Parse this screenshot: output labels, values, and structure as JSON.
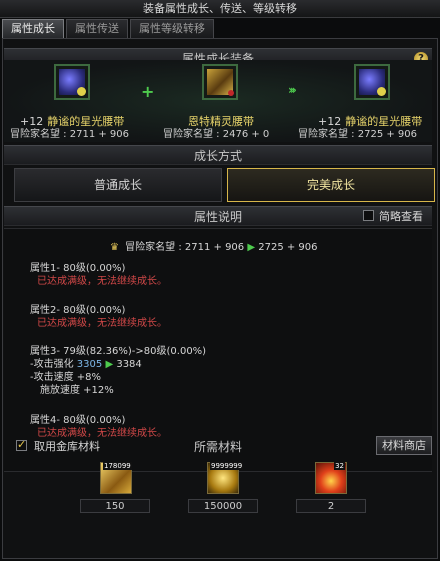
{
  "window": {
    "title": "装备属性成长、传送、等级转移"
  },
  "tabs": [
    {
      "label": "属性成长"
    },
    {
      "label": "属性传送"
    },
    {
      "label": "属性等级转移"
    }
  ],
  "equip_section": {
    "title": "属性成长装备",
    "help": "?",
    "source": {
      "plus": "+12",
      "name": "静谧的星光腰带",
      "score_label": "冒险家名望 : 2711 + 906"
    },
    "material": {
      "name": "恩特精灵腰带",
      "score_label": "冒险家名望 : 2476 + 0"
    },
    "result": {
      "plus": "+12",
      "name": "静谧的星光腰带",
      "score_label": "冒险家名望 : 2725 + 906"
    }
  },
  "growth_method": {
    "title": "成长方式",
    "options": [
      "普通成长",
      "完美成长"
    ],
    "selected": "完美成长"
  },
  "attr_desc": {
    "title": "属性说明",
    "brief_view_label": "简略查看",
    "brief_view_checked": false,
    "fame": {
      "label": "冒险家名望 : 2711 + 906",
      "arrow": "▶",
      "new": "2725 + 906"
    },
    "attrs": [
      {
        "head": "属性1- 80级(0.00%)",
        "note": "已达成满级，无法继续成长。"
      },
      {
        "head": "属性2- 80级(0.00%)",
        "note": "已达成满级，无法继续成长。"
      },
      {
        "head": "属性3- 79级(82.36%)->80级(0.00%)",
        "lines": [
          {
            "label": "-攻击强化",
            "value": "3305",
            "arrow": "▶",
            "new": "3384"
          },
          {
            "label": "-攻击速度 +8%"
          },
          {
            "label": "施放速度 +12%"
          }
        ]
      },
      {
        "head": "属性4- 80级(0.00%)",
        "note": "已达成满级，无法继续成长。"
      }
    ]
  },
  "materials": {
    "use_vault_label": "取用金库材料",
    "use_vault_checked": true,
    "title": "所需材料",
    "shop_button": "材料商店",
    "items": [
      {
        "icon": "gold-bar-icon",
        "stock": "178099",
        "qty": "150"
      },
      {
        "icon": "gold-coins-icon",
        "stock": "9999999",
        "qty": "150000"
      },
      {
        "icon": "flame-orb-icon",
        "stock": "32",
        "qty": "2"
      }
    ]
  }
}
